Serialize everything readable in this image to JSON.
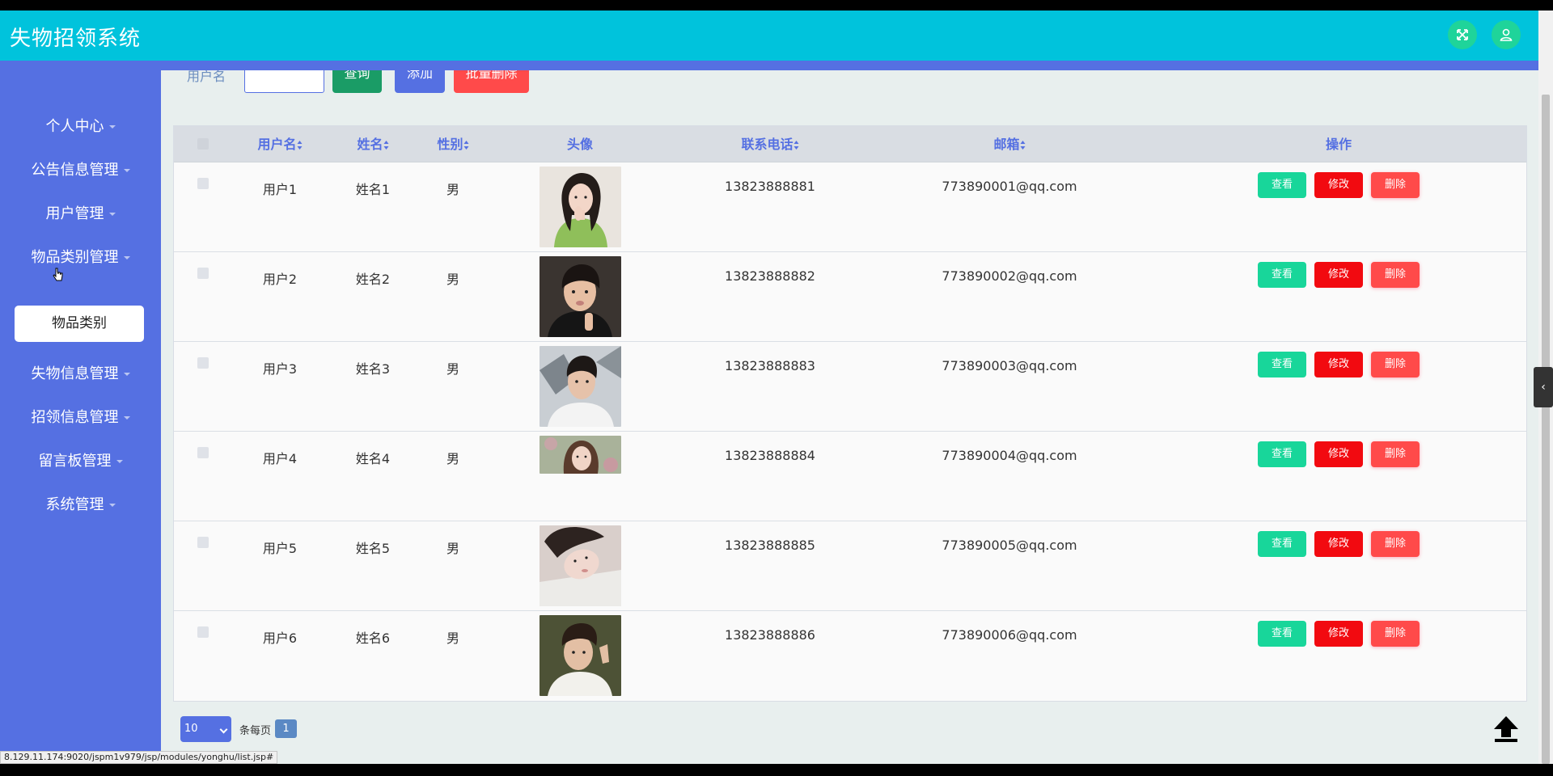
{
  "app": {
    "title": "失物招领系统"
  },
  "topbar": {
    "fullscreen_icon": "expand-arrows-icon",
    "user_icon": "user-icon"
  },
  "sidebar": {
    "items": [
      {
        "label": "个人中心"
      },
      {
        "label": "公告信息管理"
      },
      {
        "label": "用户管理"
      },
      {
        "label": "物品类别管理"
      },
      {
        "label": "失物信息管理"
      },
      {
        "label": "招领信息管理"
      },
      {
        "label": "留言板管理"
      },
      {
        "label": "系统管理"
      }
    ],
    "expanded_sub": {
      "label": "物品类别"
    }
  },
  "search": {
    "label": "用户名",
    "input_value": "",
    "query_label": "查询",
    "add_label": "添加",
    "bulk_delete_label": "批量删除"
  },
  "table": {
    "columns": [
      "用户名",
      "姓名",
      "性别",
      "头像",
      "联系电话",
      "邮箱",
      "操作"
    ],
    "rows": [
      {
        "username": "用户1",
        "name": "姓名1",
        "gender": "男",
        "phone": "13823888881",
        "email": "773890001@qq.com"
      },
      {
        "username": "用户2",
        "name": "姓名2",
        "gender": "男",
        "phone": "13823888882",
        "email": "773890002@qq.com"
      },
      {
        "username": "用户3",
        "name": "姓名3",
        "gender": "男",
        "phone": "13823888883",
        "email": "773890003@qq.com"
      },
      {
        "username": "用户4",
        "name": "姓名4",
        "gender": "男",
        "phone": "13823888884",
        "email": "773890004@qq.com"
      },
      {
        "username": "用户5",
        "name": "姓名5",
        "gender": "男",
        "phone": "13823888885",
        "email": "773890005@qq.com"
      },
      {
        "username": "用户6",
        "name": "姓名6",
        "gender": "男",
        "phone": "13823888886",
        "email": "773890006@qq.com"
      }
    ],
    "actions": {
      "view": "查看",
      "edit": "修改",
      "delete": "删除"
    }
  },
  "pager": {
    "page_size": "10",
    "per_page_label": "条每页",
    "current_page": "1"
  },
  "status_bar": {
    "url": "8.129.11.174:9020/jspm1v979/jsp/modules/yonghu/list.jsp#"
  },
  "colors": {
    "topbar": "#00c3dc",
    "sidebar": "#5570e2",
    "view": "#18d69a",
    "edit": "#f20a10",
    "delete": "#ff4a4a"
  }
}
